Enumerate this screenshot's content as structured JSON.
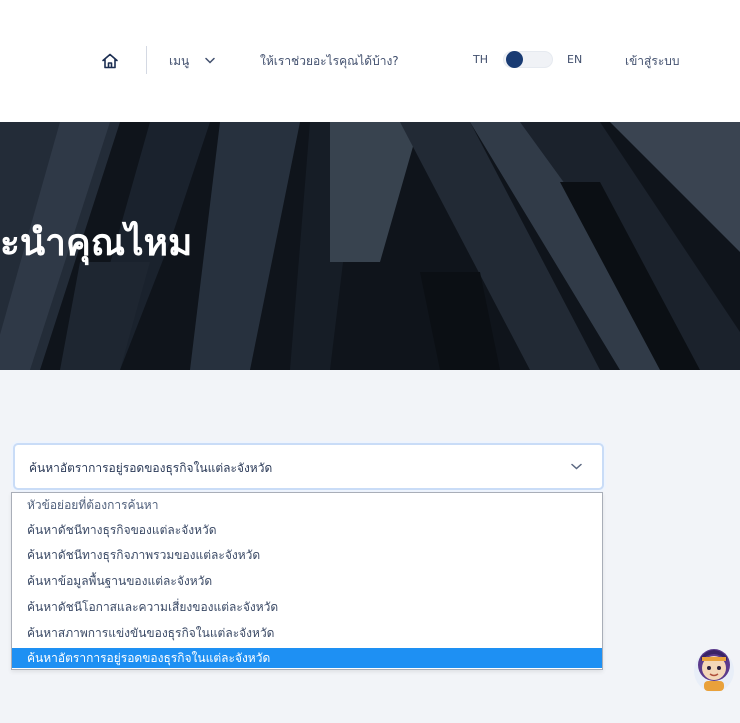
{
  "nav": {
    "menu_label": "เมนู",
    "help_label": "ให้เราช่วยอะไรคุณได้บ้าง?",
    "lang_th": "TH",
    "lang_en": "EN",
    "login_label": "เข้าสู่ระบบ"
  },
  "hero": {
    "title": "ะนำคุณไหม"
  },
  "search": {
    "selected_value": "ค้นหาอัตราการอยู่รอดของธุรกิจในแต่ละจังหวัด",
    "options": [
      "หัวข้อย่อยที่ต้องการค้นหา",
      "ค้นหาดัชนีทางธุรกิจของแต่ละจังหวัด",
      "ค้นหาดัชนีทางธุรกิจภาพรวมของแต่ละจังหวัด",
      "ค้นหาข้อมูลพื้นฐานของแต่ละจังหวัด",
      "ค้นหาดัชนีโอกาสและความเสี่ยงของแต่ละจังหวัด",
      "ค้นหาสภาพการแข่งขันของธุรกิจในแต่ละจังหวัด",
      "ค้นหาอัตราการอยู่รอดของธุรกิจในแต่ละจังหวัด"
    ]
  },
  "colors": {
    "selected_option_bg": "#1e90f3",
    "toggle_knob": "#193b73",
    "hero_bg": "#0d1117"
  },
  "icons": {
    "home": "home-icon",
    "menu_chevron": "chevron-down-icon",
    "select_chevron": "chevron-down-icon",
    "mascot": "chatbot-mascot-icon"
  }
}
